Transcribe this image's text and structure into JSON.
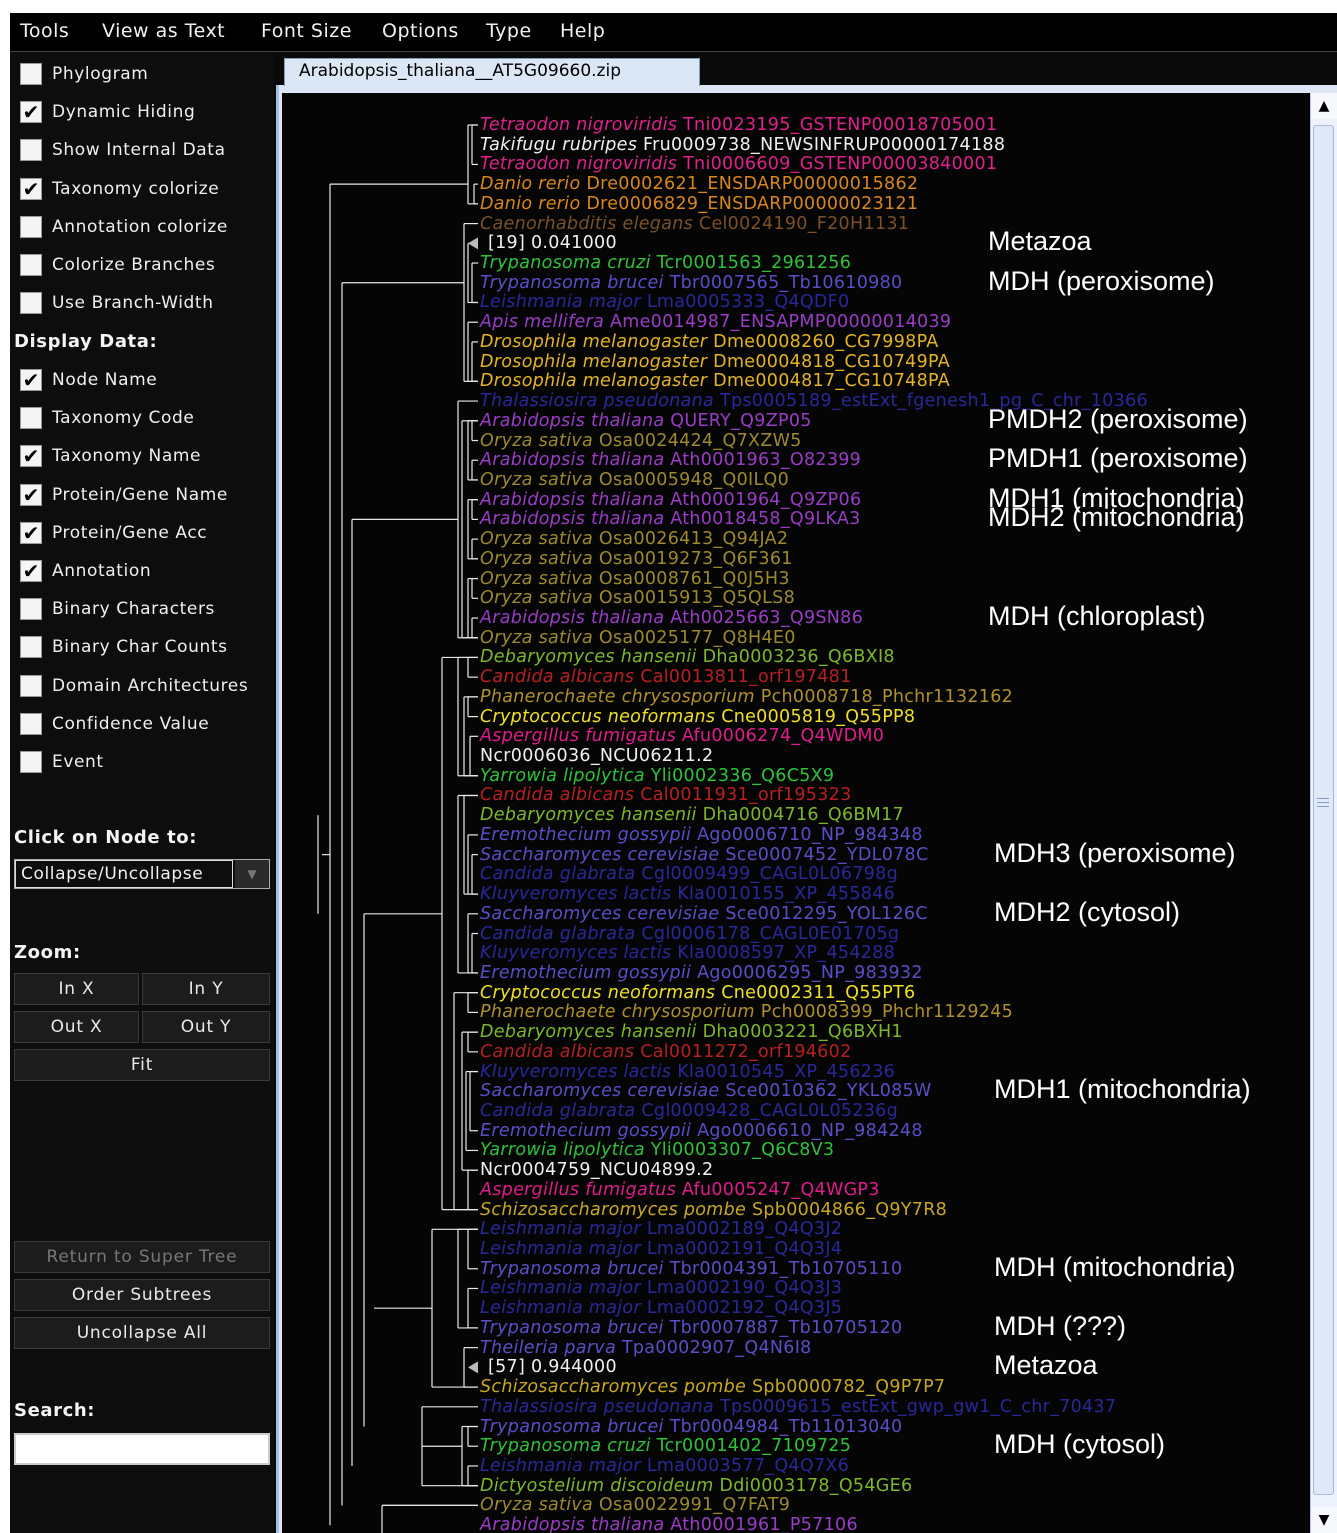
{
  "menu": [
    "Tools",
    "View as Text",
    "Font Size",
    "Options",
    "Type",
    "Help"
  ],
  "options": [
    {
      "label": "Phylogram",
      "checked": false
    },
    {
      "label": "Dynamic Hiding",
      "checked": true
    },
    {
      "label": "Show Internal Data",
      "checked": false
    },
    {
      "label": "Taxonomy colorize",
      "checked": true
    },
    {
      "label": "Annotation colorize",
      "checked": false
    },
    {
      "label": "Colorize Branches",
      "checked": false
    },
    {
      "label": "Use Branch-Width",
      "checked": false
    }
  ],
  "display_data_heading": "Display Data:",
  "display_options": [
    {
      "label": "Node Name",
      "checked": true
    },
    {
      "label": "Taxonomy Code",
      "checked": false
    },
    {
      "label": "Taxonomy Name",
      "checked": true
    },
    {
      "label": "Protein/Gene Name",
      "checked": true
    },
    {
      "label": "Protein/Gene Acc",
      "checked": true
    },
    {
      "label": "Annotation",
      "checked": true
    },
    {
      "label": "Binary Characters",
      "checked": false
    },
    {
      "label": "Binary Char Counts",
      "checked": false
    },
    {
      "label": "Domain Architectures",
      "checked": false
    },
    {
      "label": "Confidence Value",
      "checked": false
    },
    {
      "label": "Event",
      "checked": false
    }
  ],
  "click_node_heading": "Click on Node to:",
  "click_node_value": "Collapse/Uncollapse",
  "zoom_heading": "Zoom:",
  "zoom_buttons": {
    "in_x": "In X",
    "in_y": "In Y",
    "out_x": "Out X",
    "out_y": "Out Y",
    "fit": "Fit"
  },
  "action_buttons": {
    "return": "Return to Super Tree",
    "order": "Order Subtrees",
    "uncollapse": "Uncollapse All"
  },
  "search_heading": "Search:",
  "search_value": "",
  "tab_title": "Arabidopsis_thaliana__AT5G09660.zip",
  "colors": {
    "magenta": "#e0208c",
    "white": "#f0f0f0",
    "orange": "#d9861c",
    "gold": "#e6b420",
    "brown": "#7a5028",
    "green": "#2ec23a",
    "blue": "#5a4ec8",
    "darkblue": "#28289a",
    "purple": "#9a3cc8",
    "olive": "#9c8a2c",
    "lime": "#7cb82a",
    "red": "#b82020",
    "tan": "#b0902a",
    "yellow": "#f0e020",
    "pink": "#e01c8c",
    "darkyellow": "#c8a820"
  },
  "leaves": [
    {
      "sp": "Tetraodon nigroviridis",
      "id": "Tni0023195_GSTENP00018705001",
      "c": "magenta"
    },
    {
      "sp": "Takifugu rubripes",
      "id": "Fru0009738_NEWSINFRUP00000174188",
      "c": "white"
    },
    {
      "sp": "Tetraodon nigroviridis",
      "id": "Tni0006609_GSTENP00003840001",
      "c": "magenta"
    },
    {
      "sp": "Danio rerio",
      "id": "Dre0002621_ENSDARP00000015862",
      "c": "orange"
    },
    {
      "sp": "Danio rerio",
      "id": "Dre0006829_ENSDARP00000023121",
      "c": "orange"
    },
    {
      "sp": "Caenorhabditis elegans",
      "id": "Cel0024190_F20H1131",
      "c": "brown"
    },
    {
      "sp": "",
      "id": "[19] 0.041000",
      "c": "white",
      "collapsed": true
    },
    {
      "sp": "Trypanosoma cruzi",
      "id": "Tcr0001563_2961256",
      "c": "green"
    },
    {
      "sp": "Trypanosoma brucei",
      "id": "Tbr0007565_Tb10610980",
      "c": "blue"
    },
    {
      "sp": "Leishmania major",
      "id": "Lma0005333_Q4QDF0",
      "c": "darkblue"
    },
    {
      "sp": "Apis mellifera",
      "id": "Ame0014987_ENSAPMP00000014039",
      "c": "purple"
    },
    {
      "sp": "Drosophila melanogaster",
      "id": "Dme0008260_CG7998PA",
      "c": "gold"
    },
    {
      "sp": "Drosophila melanogaster",
      "id": "Dme0004818_CG10749PA",
      "c": "gold"
    },
    {
      "sp": "Drosophila melanogaster",
      "id": "Dme0004817_CG10748PA",
      "c": "gold"
    },
    {
      "sp": "Thalassiosira pseudonana",
      "id": "Tps0005189_estExt_fgenesh1_pg_C_chr_10366",
      "c": "darkblue"
    },
    {
      "sp": "Arabidopsis thaliana",
      "id": "QUERY_Q9ZP05",
      "c": "purple"
    },
    {
      "sp": "Oryza sativa",
      "id": "Osa0024424_Q7XZW5",
      "c": "olive"
    },
    {
      "sp": "Arabidopsis thaliana",
      "id": "Ath0001963_O82399",
      "c": "purple"
    },
    {
      "sp": "Oryza sativa",
      "id": "Osa0005948_Q0ILQ0",
      "c": "olive"
    },
    {
      "sp": "Arabidopsis thaliana",
      "id": "Ath0001964_Q9ZP06",
      "c": "purple"
    },
    {
      "sp": "Arabidopsis thaliana",
      "id": "Ath0018458_Q9LKA3",
      "c": "purple"
    },
    {
      "sp": "Oryza sativa",
      "id": "Osa0026413_Q94JA2",
      "c": "olive"
    },
    {
      "sp": "Oryza sativa",
      "id": "Osa0019273_Q6F361",
      "c": "olive"
    },
    {
      "sp": "Oryza sativa",
      "id": "Osa0008761_Q0J5H3",
      "c": "olive"
    },
    {
      "sp": "Oryza sativa",
      "id": "Osa0015913_Q5QLS8",
      "c": "olive"
    },
    {
      "sp": "Arabidopsis thaliana",
      "id": "Ath0025663_Q9SN86",
      "c": "purple"
    },
    {
      "sp": "Oryza sativa",
      "id": "Osa0025177_Q8H4E0",
      "c": "olive"
    },
    {
      "sp": "Debaryomyces hansenii",
      "id": "Dha0003236_Q6BXI8",
      "c": "lime"
    },
    {
      "sp": "Candida albicans",
      "id": "Cal0013811_orf197481",
      "c": "red"
    },
    {
      "sp": "Phanerochaete chrysosporium",
      "id": "Pch0008718_Phchr1132162",
      "c": "tan"
    },
    {
      "sp": "Cryptococcus neoformans",
      "id": "Cne0005819_Q55PP8",
      "c": "yellow"
    },
    {
      "sp": "Aspergillus fumigatus",
      "id": "Afu0006274_Q4WDM0",
      "c": "pink"
    },
    {
      "sp": "",
      "id": "Ncr0006036_NCU06211.2",
      "c": "white"
    },
    {
      "sp": "Yarrowia lipolytica",
      "id": "Yli0002336_Q6C5X9",
      "c": "green"
    },
    {
      "sp": "Candida albicans",
      "id": "Cal0011931_orf195323",
      "c": "red"
    },
    {
      "sp": "Debaryomyces hansenii",
      "id": "Dha0004716_Q6BM17",
      "c": "lime"
    },
    {
      "sp": "Eremothecium gossypii",
      "id": "Ago0006710_NP_984348",
      "c": "blue"
    },
    {
      "sp": "Saccharomyces cerevisiae",
      "id": "Sce0007452_YDL078C",
      "c": "blue"
    },
    {
      "sp": "Candida glabrata",
      "id": "Cgl0009499_CAGL0L06798g",
      "c": "darkblue"
    },
    {
      "sp": "Kluyveromyces lactis",
      "id": "Kla0010155_XP_455846",
      "c": "darkblue"
    },
    {
      "sp": "Saccharomyces cerevisiae",
      "id": "Sce0012295_YOL126C",
      "c": "blue"
    },
    {
      "sp": "Candida glabrata",
      "id": "Cgl0006178_CAGL0E01705g",
      "c": "darkblue"
    },
    {
      "sp": "Kluyveromyces lactis",
      "id": "Kla0008597_XP_454288",
      "c": "darkblue"
    },
    {
      "sp": "Eremothecium gossypii",
      "id": "Ago0006295_NP_983932",
      "c": "blue"
    },
    {
      "sp": "Cryptococcus neoformans",
      "id": "Cne0002311_Q55PT6",
      "c": "yellow"
    },
    {
      "sp": "Phanerochaete chrysosporium",
      "id": "Pch0008399_Phchr1129245",
      "c": "tan"
    },
    {
      "sp": "Debaryomyces hansenii",
      "id": "Dha0003221_Q6BXH1",
      "c": "lime"
    },
    {
      "sp": "Candida albicans",
      "id": "Cal0011272_orf194602",
      "c": "red"
    },
    {
      "sp": "Kluyveromyces lactis",
      "id": "Kla0010545_XP_456236",
      "c": "darkblue"
    },
    {
      "sp": "Saccharomyces cerevisiae",
      "id": "Sce0010362_YKL085W",
      "c": "blue"
    },
    {
      "sp": "Candida glabrata",
      "id": "Cgl0009428_CAGL0L05236g",
      "c": "darkblue"
    },
    {
      "sp": "Eremothecium gossypii",
      "id": "Ago0006610_NP_984248",
      "c": "blue"
    },
    {
      "sp": "Yarrowia lipolytica",
      "id": "Yli0003307_Q6C8V3",
      "c": "green"
    },
    {
      "sp": "",
      "id": "Ncr0004759_NCU04899.2",
      "c": "white"
    },
    {
      "sp": "Aspergillus fumigatus",
      "id": "Afu0005247_Q4WGP3",
      "c": "pink"
    },
    {
      "sp": "Schizosaccharomyces pombe",
      "id": "Spb0004866_Q9Y7R8",
      "c": "darkyellow"
    },
    {
      "sp": "Leishmania major",
      "id": "Lma0002189_Q4Q3J2",
      "c": "darkblue"
    },
    {
      "sp": "Leishmania major",
      "id": "Lma0002191_Q4Q3J4",
      "c": "darkblue"
    },
    {
      "sp": "Trypanosoma brucei",
      "id": "Tbr0004391_Tb10705110",
      "c": "blue"
    },
    {
      "sp": "Leishmania major",
      "id": "Lma0002190_Q4Q3J3",
      "c": "darkblue"
    },
    {
      "sp": "Leishmania major",
      "id": "Lma0002192_Q4Q3J5",
      "c": "darkblue"
    },
    {
      "sp": "Trypanosoma brucei",
      "id": "Tbr0007887_Tb10705120",
      "c": "blue"
    },
    {
      "sp": "Theileria parva",
      "id": "Tpa0002907_Q4N6I8",
      "c": "blue"
    },
    {
      "sp": "",
      "id": "[57] 0.944000",
      "c": "white",
      "collapsed": true
    },
    {
      "sp": "Schizosaccharomyces pombe",
      "id": "Spb0000782_Q9P7P7",
      "c": "darkyellow"
    },
    {
      "sp": "Thalassiosira pseudonana",
      "id": "Tps0009615_estExt_gwp_gw1_C_chr_70437",
      "c": "darkblue"
    },
    {
      "sp": "Trypanosoma brucei",
      "id": "Tbr0004984_Tb11013040",
      "c": "blue"
    },
    {
      "sp": "Trypanosoma cruzi",
      "id": "Tcr0001402_7109725",
      "c": "green"
    },
    {
      "sp": "Leishmania major",
      "id": "Lma0003577_Q4Q7X6",
      "c": "darkblue"
    },
    {
      "sp": "Dictyostelium discoideum",
      "id": "Ddi0003178_Q54GE6",
      "c": "lime"
    },
    {
      "sp": "Oryza sativa",
      "id": "Osa0022991_Q7FAT9",
      "c": "olive"
    },
    {
      "sp": "Arabidopsis thaliana",
      "id": "Ath0001961_P57106",
      "c": "purple"
    }
  ],
  "annotations": [
    {
      "text": "Metazoa",
      "row": 6
    },
    {
      "text": "MDH (peroxisome)",
      "row": 8
    },
    {
      "text": "PMDH2 (peroxisome)",
      "row": 15
    },
    {
      "text": "PMDH1 (peroxisome)",
      "row": 17
    },
    {
      "text": "MDH1 (mitochondria)",
      "row": 19
    },
    {
      "text": "MDH2 (mitochondria)",
      "row": 20
    },
    {
      "text": "MDH (chloroplast)",
      "row": 25
    },
    {
      "text": "MDH3 (peroxisome)",
      "row": 37
    },
    {
      "text": "MDH2 (cytosol)",
      "row": 40
    },
    {
      "text": "MDH1 (mitochondria)",
      "row": 49
    },
    {
      "text": "MDH (mitochondria)",
      "row": 58
    },
    {
      "text": "MDH (???)",
      "row": 61
    },
    {
      "text": "Metazoa",
      "row": 63
    },
    {
      "text": "MDH (cytosol)",
      "row": 67
    }
  ]
}
